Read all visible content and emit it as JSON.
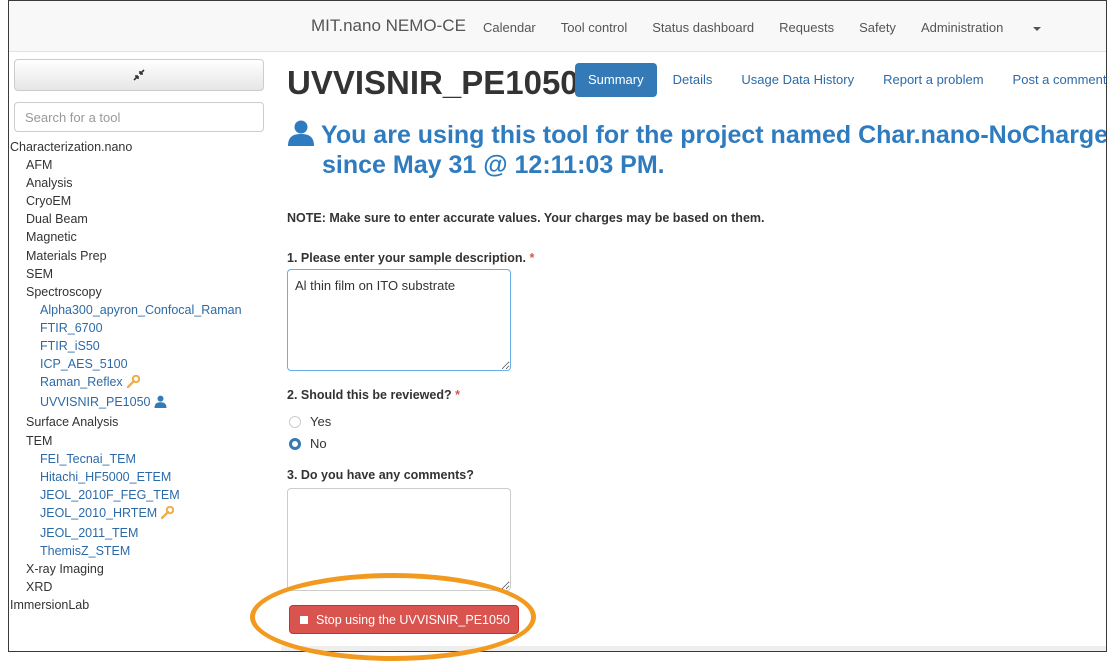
{
  "navbar": {
    "brand": "MIT.nano NEMO-CE",
    "links": [
      "Calendar",
      "Tool control",
      "Status dashboard",
      "Requests",
      "Safety",
      "Administration"
    ]
  },
  "sidebar": {
    "search_placeholder": "Search for a tool",
    "tree": [
      {
        "label": "Characterization.nano",
        "level": 0
      },
      {
        "label": "AFM",
        "level": 1
      },
      {
        "label": "Analysis",
        "level": 1
      },
      {
        "label": "CryoEM",
        "level": 1
      },
      {
        "label": "Dual Beam",
        "level": 1
      },
      {
        "label": "Magnetic",
        "level": 1
      },
      {
        "label": "Materials Prep",
        "level": 1
      },
      {
        "label": "SEM",
        "level": 1
      },
      {
        "label": "Spectroscopy",
        "level": 1
      },
      {
        "label": "Alpha300_apyron_Confocal_Raman",
        "level": 2
      },
      {
        "label": "FTIR_6700",
        "level": 2
      },
      {
        "label": "FTIR_iS50",
        "level": 2
      },
      {
        "label": "ICP_AES_5100",
        "level": 2
      },
      {
        "label": "Raman_Reflex",
        "level": 2,
        "icon": "wrench-icon"
      },
      {
        "label": "UVVISNIR_PE1050",
        "level": 2,
        "icon": "user-icon",
        "selected": true
      },
      {
        "label": "Surface Analysis",
        "level": 1
      },
      {
        "label": "TEM",
        "level": 1
      },
      {
        "label": "FEI_Tecnai_TEM",
        "level": 2
      },
      {
        "label": "Hitachi_HF5000_ETEM",
        "level": 2
      },
      {
        "label": "JEOL_2010F_FEG_TEM",
        "level": 2
      },
      {
        "label": "JEOL_2010_HRTEM",
        "level": 2,
        "icon": "wrench-icon"
      },
      {
        "label": "JEOL_2011_TEM",
        "level": 2
      },
      {
        "label": "ThemisZ_STEM",
        "level": 2
      },
      {
        "label": "X-ray Imaging",
        "level": 1
      },
      {
        "label": "XRD",
        "level": 1
      },
      {
        "label": "ImmersionLab",
        "level": 0
      }
    ]
  },
  "main": {
    "title": "UVVISNIR_PE1050",
    "tabs": [
      {
        "label": "Summary",
        "active": true
      },
      {
        "label": "Details"
      },
      {
        "label": "Usage Data History"
      },
      {
        "label": "Report a problem"
      },
      {
        "label": "Post a comment"
      }
    ],
    "banner_line1": "You are using this tool for the project named Char.nano-NoCharge",
    "banner_line2": "since May 31 @ 12:11:03 PM.",
    "note": "NOTE: Make sure to enter accurate values. Your charges may be based on them.",
    "q1": {
      "label": "1. Please enter your sample description.",
      "required": "*",
      "value": "Al thin film on ITO substrate"
    },
    "q2": {
      "label": "2. Should this be reviewed?",
      "required": "*",
      "options": [
        "Yes",
        "No"
      ],
      "selected": "No"
    },
    "q3": {
      "label": "3. Do you have any comments?",
      "value": ""
    },
    "stop_button": "Stop using the UVVISNIR_PE1050"
  },
  "colors": {
    "accent": "#337ab7",
    "banner": "#2e7cbf",
    "danger": "#d9534f",
    "wrench": "#f0ad4e",
    "highlight": "#f29a1f"
  }
}
